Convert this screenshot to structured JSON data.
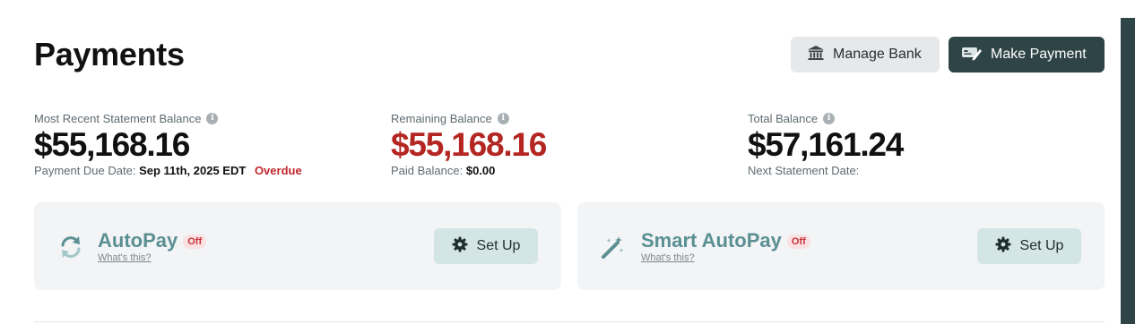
{
  "page": {
    "title": "Payments"
  },
  "header": {
    "manage_bank_label": "Manage Bank",
    "make_payment_label": "Make Payment"
  },
  "stats": [
    {
      "label": "Most Recent Statement Balance",
      "value": "$55,168.16",
      "sub_label": "Payment Due Date:",
      "sub_value": "Sep 11th, 2025 EDT",
      "status": "Overdue"
    },
    {
      "label": "Remaining Balance",
      "value": "$55,168.16",
      "sub_label": "Paid Balance:",
      "sub_value": "$0.00"
    },
    {
      "label": "Total Balance",
      "value": "$57,161.24",
      "sub_label": "Next Statement Date:"
    }
  ],
  "cards": [
    {
      "title": "AutoPay",
      "badge": "Off",
      "link": "What's this?",
      "button": "Set Up",
      "icon": "refresh-icon"
    },
    {
      "title": "Smart AutoPay",
      "badge": "Off",
      "link": "What's this?",
      "button": "Set Up",
      "icon": "magic-wand-icon"
    }
  ],
  "colors": {
    "primary_dark": "#2e4447",
    "accent_teal": "#5b9093",
    "danger_red": "#b42621",
    "card_bg": "#f2f4f6",
    "setup_bg": "#d4e5e6"
  }
}
